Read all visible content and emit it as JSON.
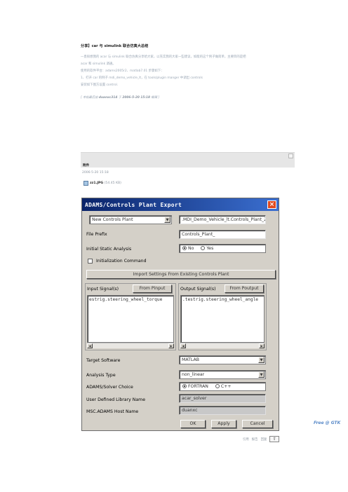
{
  "post": {
    "title": "分享】car 与 simulink 联合仿真大总结",
    "lines": [
      "一直很想我的 acar 与 simulink 联合仿真分享给大家，以充实我的大家一些建议，如能的这个例子做简单，主要目的是把",
      "acar 和 simulink 调通。",
      "使用的软件平台：adams2005r2、matlab7.01     步骤如下：",
      "1、打开 car 的例子 mdi_demo_vehicle_lt，在 tools/plugin manger 中调出 controls",
      "安装如下图方设置 control."
    ],
    "edited_prefix": "[",
    "edited_text": "本帖最后由",
    "edited_user": "duanxc314",
    "edited_mid": "于",
    "edited_time": "2006-5-20 15:18",
    "edited_suffix": "编辑 ]"
  },
  "attachment": {
    "label": "附件",
    "date": "2006-5-20 15:18",
    "file_name": "zz1.JPG",
    "file_size": "(54.45 KB)"
  },
  "dialog": {
    "title": "ADAMS/Controls Plant Export",
    "close_glyph": "×",
    "plant_combo": "New Controls Plant",
    "model_field": ".MDI_Demo_Vehicle_lt.Controls_Plant_2",
    "file_prefix_label": "File Prefix",
    "file_prefix_value": "Controls_Plant_",
    "initial_static_label": "Initial Static Analysis",
    "radio_no": "No",
    "radio_yes": "Yes",
    "init_command_label": "Initialization Command",
    "import_button": "Import Settings From Existing Controls Plant",
    "input_signals_label": "Input Signal(s)",
    "from_pinput_button": "From Pinput",
    "output_signals_label": "Output Signal(s)",
    "from_poutput_button": "From Poutput",
    "input_signal_value": "estrig.steering_wheel_torque",
    "output_signal_value": ".testrig.steering_wheel_angle",
    "target_software_label": "Target Software",
    "target_software_value": "MATLAB",
    "analysis_type_label": "Analysis Type",
    "analysis_type_value": "non_linear",
    "solver_choice_label": "ADAMS/Solver Choice",
    "solver_fortran": "FORTRAN",
    "solver_cpp": "C++",
    "user_library_label": "User Defined Library Name",
    "user_library_value": "acar_solver",
    "host_name_label": "MSC.ADAMS Host Name",
    "host_name_value": "duanxc",
    "ok_button": "OK",
    "apply_button": "Apply",
    "cancel_button": "Cancel"
  },
  "watermark": "Free @ GTK",
  "bottom": {
    "quote": "引用",
    "report": "报告",
    "reply": "回复",
    "top_glyph": "⇧"
  },
  "colors": {
    "titlebar": "#0a246a",
    "dialog_bg": "#d4d0c8",
    "close": "#e14a1e"
  },
  "icons": [
    "close-icon",
    "dropdown-arrow-icon",
    "image-file-icon",
    "scroll-left-icon",
    "scroll-right-icon",
    "back-to-top-icon"
  ]
}
